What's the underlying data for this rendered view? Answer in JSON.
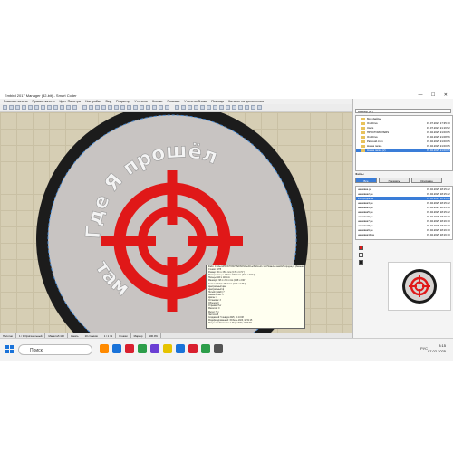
{
  "window": {
    "title": "Embird 2017 Manager (32-bit) - Smart Coder",
    "controls": "— ☐ ✕"
  },
  "menu": [
    "Главная панель",
    "Правка панели",
    "Цвет Палитра",
    "Настройки",
    "Вид",
    "Редактор",
    "Утилиты",
    "Кнопки",
    "Помощь",
    "Утилиты блоки",
    "Помощь",
    "Каталог на дополнения"
  ],
  "design": {
    "text_top": "Где Я прошёл",
    "text_bottom": "там",
    "colors": {
      "background": "#d6ceb4",
      "outer_ring": "#1c1c1c",
      "inner_circle": "#c8c4c2",
      "crosshair": "#e01818",
      "text": "#f4f4f4"
    }
  },
  "tooltip": {
    "lines": [
      "Файл: C:\\Users\\ПРОСТОМУ\\PERSOI\\OneDrive\\Рабочий стол\\Новая\\нетакой\\Изгородка.pe (Заменено)",
      "Стежки: 6875",
      "Размер: 96.1 x 95.1 mm (3.78 x 3.74 \")",
      "Размер пяльцы: 100.0 x 100.0 mm (3.94 x 3.94 \")",
      "Пяльцы: 110 x 110 mm",
      "Минимум: 68.1 x 66.1 mm (2.68 x 2.60 \")",
      "Колонна: 64.6 x 88.3 mm (2.54 x 3.48 \")",
      "Центральный цвет",
      "Центральный ф",
      "Нитейп (Stitch) 7",
      "Смены нитки: 3",
      "Циклы: 4",
      "Остановок: 3",
      "Обрезок: 0",
      "Отрывки: Нет",
      "Масштаб: 0",
      "",
      "Метки: Нет",
      "Частота: 8",
      "Создавший: 5 января 2025, 21:10:08",
      "Модифицированный: 15 Июнь 2023, 18:51:15",
      "Полученный/изменён: 1 Март 2023, 17:16:38"
    ]
  },
  "status": [
    "Полотно",
    "1 / 1 Оригинальный",
    "Масштаб 100",
    "Узнать",
    "10 стежков",
    "1 / 1 / 1",
    "Стежки",
    "Маркер",
    "100.0%"
  ],
  "right_panel": {
    "path": "Desktop (D:)",
    "tree": [
      {
        "name": "Мои файлы",
        "date": ""
      },
      {
        "name": "OneDrive",
        "date": "15.07.2023 17:35:10"
      },
      {
        "name": "Users",
        "date": "15.07.2023 21:16:52"
      },
      {
        "name": "ПРОСТОМУ PERS",
        "date": "07.02.2025 21:00:05"
      },
      {
        "name": "OneDrive",
        "date": "07.02.2025 21:08:56"
      },
      {
        "name": "Рабочий стол",
        "date": "07.02.2025 21:00:05"
      },
      {
        "name": "Новая папка",
        "date": "07.02.2025 21:00:05"
      },
      {
        "name": "Новая папка (2)",
        "date": "07.02.2025 21:00:05"
      }
    ],
    "tab_label": "Файлы",
    "buttons": [
      "Все",
      "Показать",
      "Описание"
    ],
    "files": [
      {
        "name": "нашивка.pe",
        "date": "07.02.2025 18:15:42"
      },
      {
        "name": "нашивка2.pe",
        "date": "07.02.2025 18:15:42"
      },
      {
        "name": "Изгородка.pe",
        "date": "07.02.2025 18:31:08"
      },
      {
        "name": "нашивка3.pe",
        "date": "07.02.2025 18:15:42"
      },
      {
        "name": "нашивка4.pe",
        "date": "07.02.2025 18:55:38"
      },
      {
        "name": "нашивка5.pe",
        "date": "07.02.2025 18:15:42"
      },
      {
        "name": "нашивка6.pe",
        "date": "07.02.2025 18:16:10"
      },
      {
        "name": "нашивка7.pe",
        "date": "07.02.2025 18:16:10"
      },
      {
        "name": "нашивка8.pe",
        "date": "07.02.2025 18:16:10"
      },
      {
        "name": "нашивка9.pe",
        "date": "07.02.2025 18:16:10"
      },
      {
        "name": "нашивка10.pe",
        "date": "07.02.2025 18:16:10"
      }
    ],
    "swatch_colors": [
      "#e01818",
      "#f4f4f4",
      "#1c1c1c"
    ]
  },
  "taskbar": {
    "search_placeholder": "Поиск",
    "lang": "РУС",
    "time": "8:15",
    "date": "07.02.2025",
    "icon_colors": [
      "#ff8a00",
      "#1a73d9",
      "#d9202f",
      "#2d9e4a",
      "#6b3fd4",
      "#e6c300",
      "#1a73d9",
      "#d9202f",
      "#2d9e4a",
      "#555555"
    ]
  }
}
